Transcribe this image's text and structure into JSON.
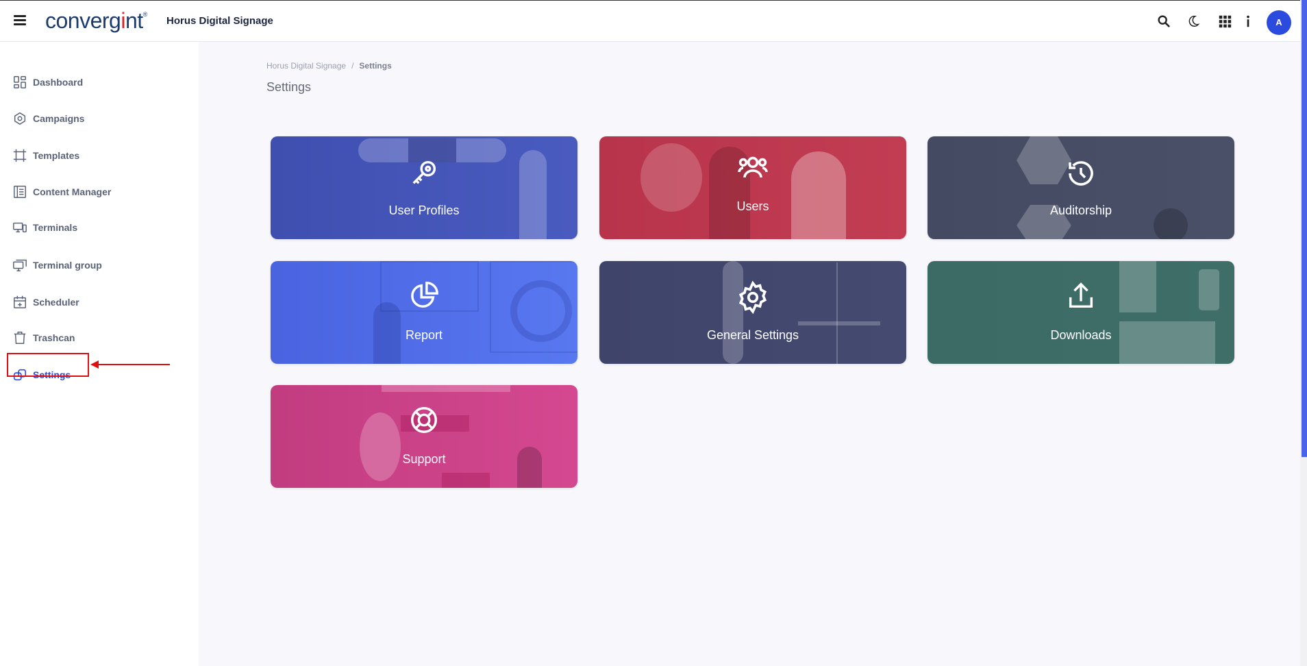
{
  "header": {
    "brand_prefix": "converg",
    "brand_i": "i",
    "brand_suffix": "nt",
    "brand_mark": "®",
    "app_title": "Horus Digital Signage",
    "avatar_initial": "A",
    "icons": [
      "menu-icon",
      "search-icon",
      "moon-icon",
      "apps-grid-icon",
      "info-icon"
    ]
  },
  "sidebar": {
    "items": [
      {
        "label": "Dashboard",
        "icon": "dashboard-icon"
      },
      {
        "label": "Campaigns",
        "icon": "campaigns-icon"
      },
      {
        "label": "Templates",
        "icon": "templates-icon"
      },
      {
        "label": "Content Manager",
        "icon": "content-manager-icon"
      },
      {
        "label": "Terminals",
        "icon": "terminals-icon"
      },
      {
        "label": "Terminal group",
        "icon": "terminal-group-icon"
      },
      {
        "label": "Scheduler",
        "icon": "scheduler-icon"
      },
      {
        "label": "Trashcan",
        "icon": "trashcan-icon"
      },
      {
        "label": "Settings",
        "icon": "settings-icon",
        "active": true
      }
    ]
  },
  "breadcrumb": {
    "root": "Horus Digital Signage",
    "separator": "/",
    "current": "Settings"
  },
  "page_title": "Settings",
  "cards": [
    {
      "label": "User Profiles",
      "icon": "key-icon",
      "color": "#4a5bc0"
    },
    {
      "label": "Users",
      "icon": "users-icon",
      "color": "#c23d52"
    },
    {
      "label": "Auditorship",
      "icon": "history-icon",
      "color": "#4a5068"
    },
    {
      "label": "Report",
      "icon": "pie-chart-icon",
      "color": "#4f6ae6"
    },
    {
      "label": "General Settings",
      "icon": "gear-icon",
      "color": "#444a70"
    },
    {
      "label": "Downloads",
      "icon": "upload-icon",
      "color": "#3f6e68"
    },
    {
      "label": "Support",
      "icon": "lifebuoy-icon",
      "color": "#cc3f86"
    }
  ],
  "colors": {
    "accent": "#2a4bde",
    "annotation": "#e01010"
  }
}
